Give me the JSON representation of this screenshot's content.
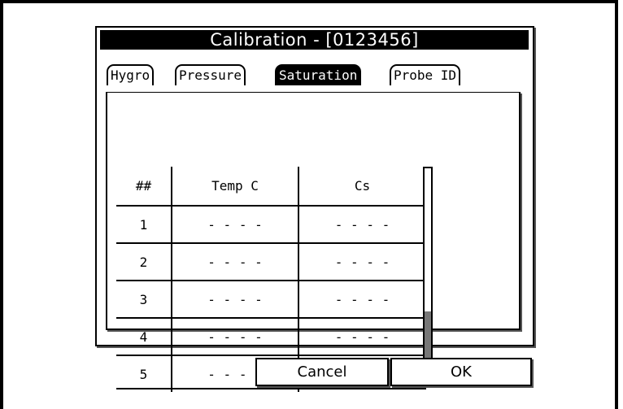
{
  "dialog": {
    "title": "Calibration - [0123456]"
  },
  "tabs": [
    {
      "label": "Hygro",
      "active": false
    },
    {
      "label": "Pressure",
      "active": false
    },
    {
      "label": "Saturation",
      "active": true
    },
    {
      "label": "Probe ID",
      "active": false
    }
  ],
  "table": {
    "headers": [
      "##",
      "Temp C",
      "Cs"
    ],
    "rows": [
      [
        "1",
        "- - - -",
        "- - - -"
      ],
      [
        "2",
        "- - - -",
        "- - - -"
      ],
      [
        "3",
        "- - - -",
        "- - - -"
      ],
      [
        "4",
        "- - - -",
        "- - - -"
      ],
      [
        "5",
        "- - - -",
        "- - - -"
      ]
    ]
  },
  "scrollbar": {
    "position_fraction": 0.67
  },
  "buttons": {
    "cancel": "Cancel",
    "ok": "OK"
  },
  "colors": {
    "titlebar_bg": "#000000",
    "active_tab_bg": "#000000",
    "scroll_thumb": "#777777"
  }
}
